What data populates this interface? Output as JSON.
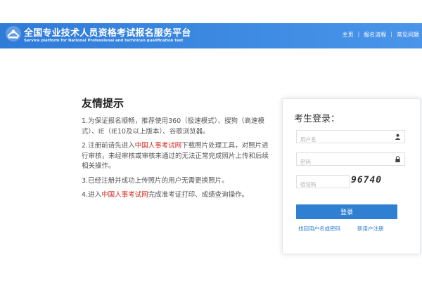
{
  "header": {
    "title": "全国专业技术人员资格考试报名服务平台",
    "subtitle": "Service platform for National Professional and technican qualification test",
    "nav": [
      "主页",
      "报名流程",
      "常见问题"
    ]
  },
  "tips": {
    "title": "友情提示",
    "items": {
      "t1": "1.为保证报名顺畅，推荐使用360（极速模式）、搜狗（高速模式）、IE（IE10及以上版本）、谷歌浏览器。",
      "t2_a": "2.注册前请先进入",
      "t2_link": "中国人事考试网",
      "t2_b": "下载照片处理工具，对照片进行审核，未经审核或审核未通过的无法正常完成照片上传和后续相关操作。",
      "t3": "3.已经注册并成功上传照片的用户无需更换照片。",
      "t4_a": "4.进入",
      "t4_link": "中国人事考试网",
      "t4_b": "完成准考证打印、成绩查询操作。"
    }
  },
  "login": {
    "title": "考生登录：",
    "username_placeholder": "用户名",
    "password_placeholder": "密码",
    "captcha_placeholder": "验证码",
    "captcha_text": "96740",
    "button": "登录",
    "forgot": "找回用户名或密码",
    "register": "新用户注册"
  },
  "colors": {
    "header_blue": "#2f7bd8",
    "button_blue": "#2f80d3",
    "link_red": "#d22a1f"
  },
  "icons": [
    "logo-icon",
    "user-icon",
    "lock-icon"
  ]
}
